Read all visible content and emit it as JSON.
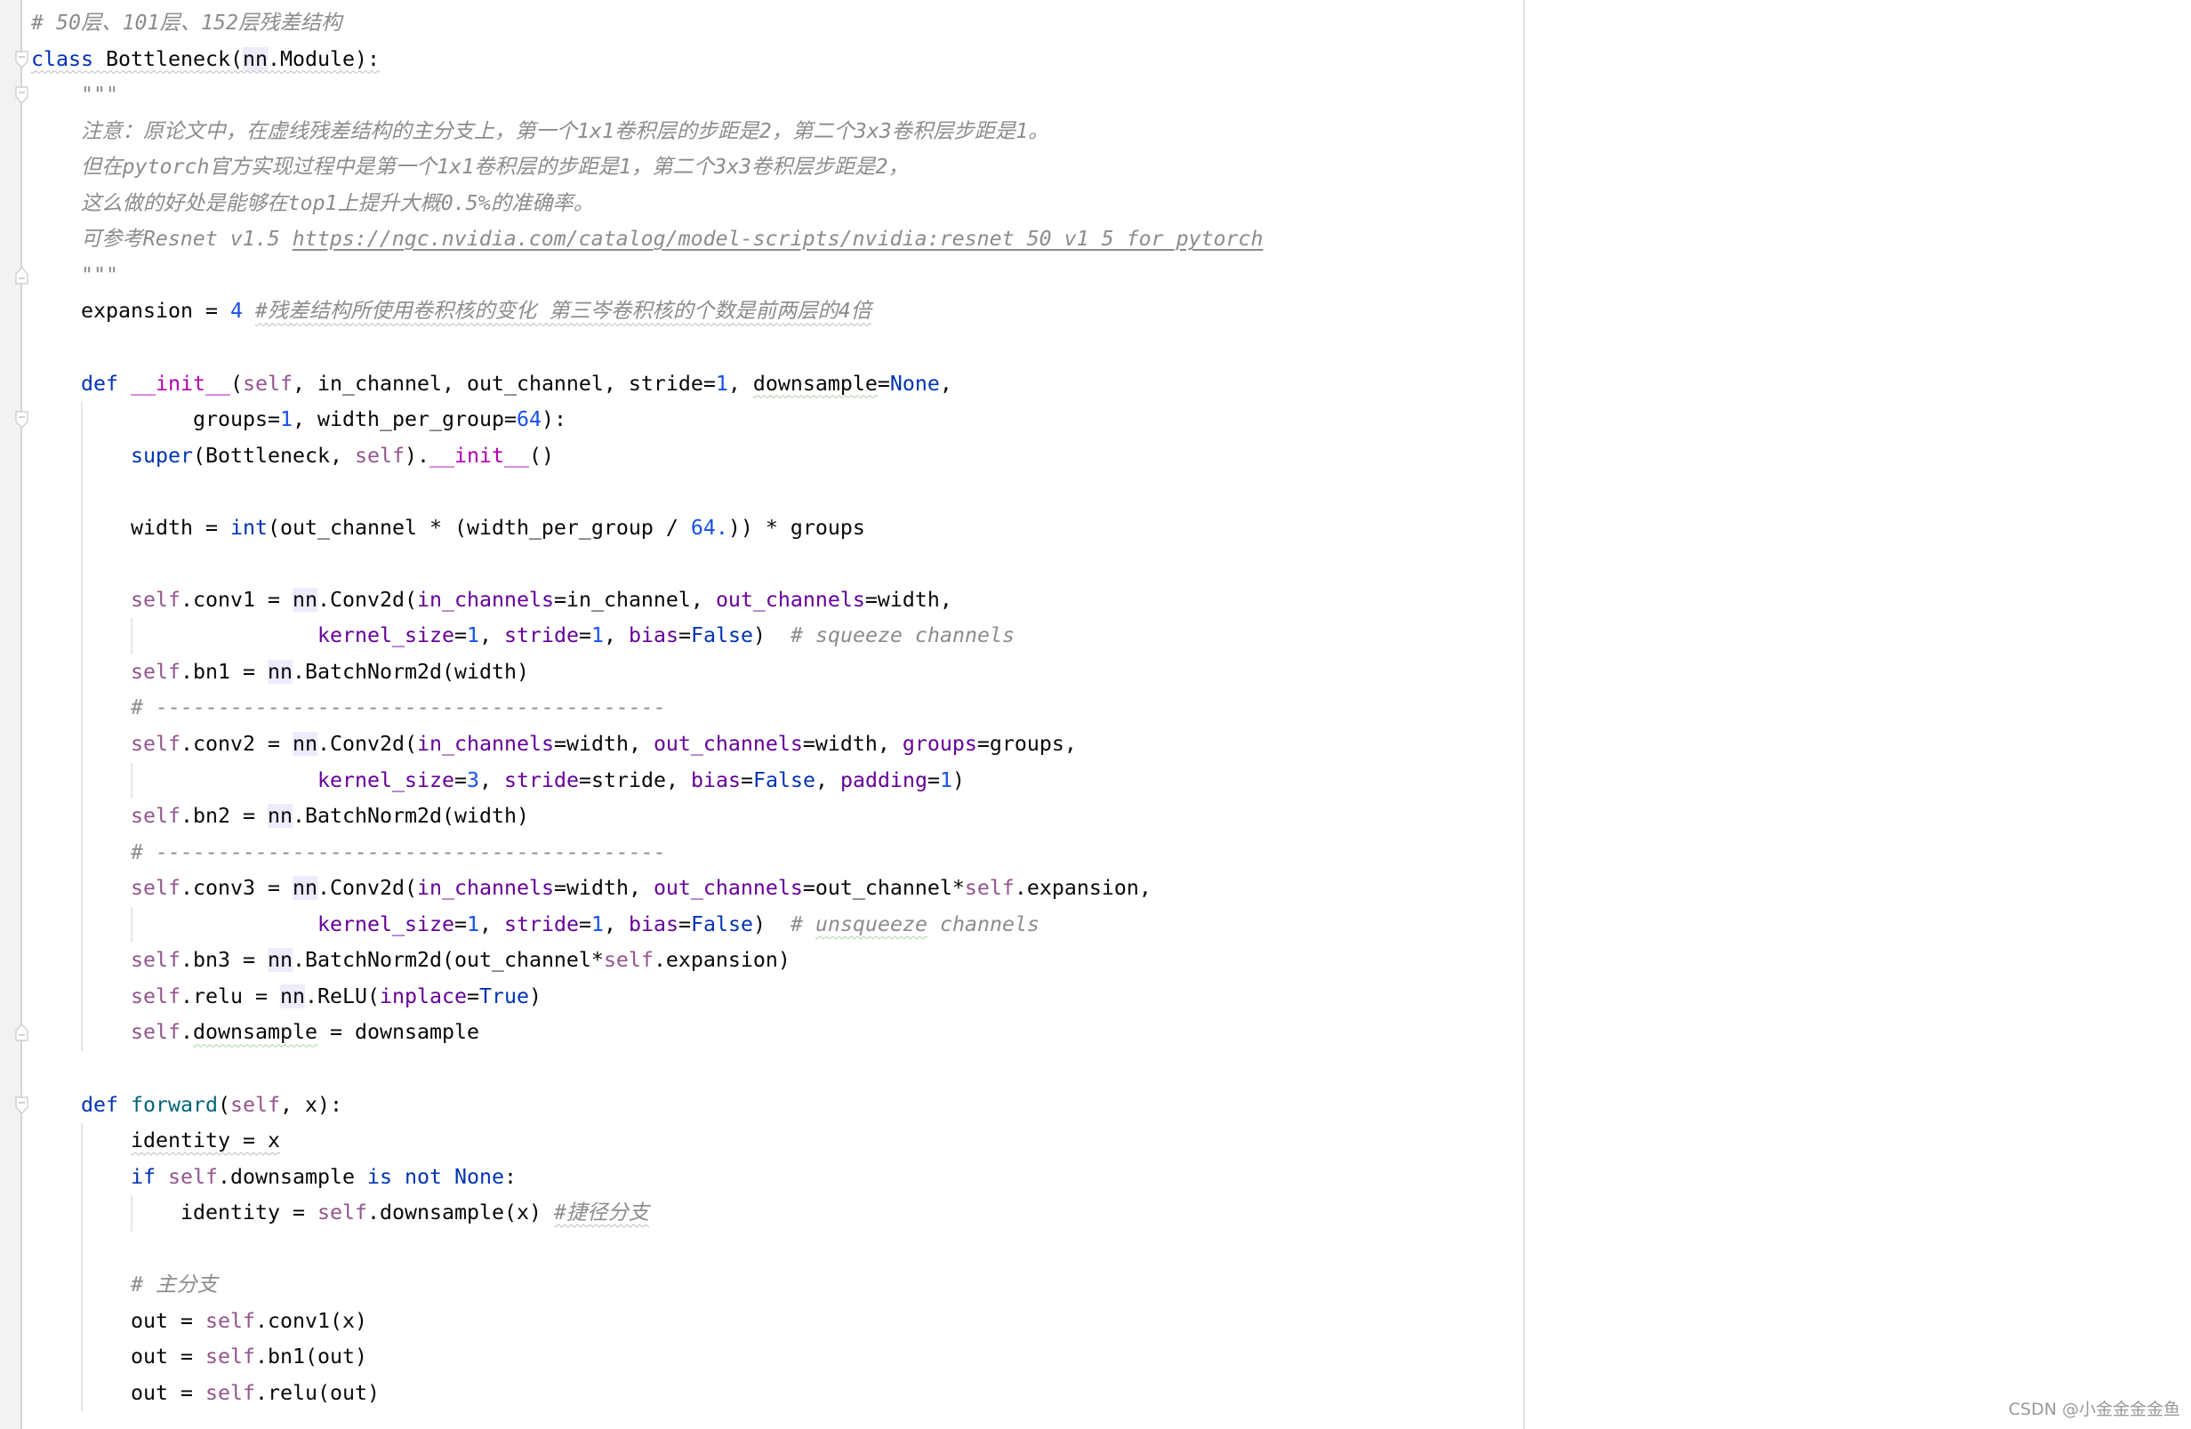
{
  "editor": {
    "language": "python",
    "lines": [
      {
        "indent": 0,
        "tokens": [
          {
            "t": "# 50层、101层、152层残差结构",
            "c": "cmt"
          }
        ]
      },
      {
        "indent": 0,
        "fold": "open",
        "tokens": [
          {
            "t": "class",
            "c": "kw sq-grey"
          },
          {
            "t": " Bottleneck(",
            "c": "plain sq-grey"
          },
          {
            "t": "nn",
            "c": "plain hl sq-grey"
          },
          {
            "t": ".Module):",
            "c": "plain sq-grey"
          }
        ]
      },
      {
        "indent": 4,
        "fold": "open",
        "tokens": [
          {
            "t": "\"\"\"",
            "c": "cmt"
          }
        ]
      },
      {
        "indent": 4,
        "tokens": [
          {
            "t": "注意：原论文中，在虚线残差结构的主分支上，第一个1x1卷积层的步距是2，第二个3x3卷积层步距是1。",
            "c": "cmt"
          }
        ]
      },
      {
        "indent": 4,
        "tokens": [
          {
            "t": "但在pytorch官方实现过程中是第一个1x1卷积层的步距是1，第二个3x3卷积层步距是2，",
            "c": "cmt"
          }
        ]
      },
      {
        "indent": 4,
        "tokens": [
          {
            "t": "这么做的好处是能够在top1上提升大概0.5%的准确率。",
            "c": "cmt"
          }
        ]
      },
      {
        "indent": 4,
        "tokens": [
          {
            "t": "可参考Resnet v1.5 ",
            "c": "cmt"
          },
          {
            "t": "https://ngc.nvidia.com/catalog/model-scripts/nvidia:resnet_50_v1_5_for_pytorch",
            "c": "url"
          }
        ]
      },
      {
        "indent": 4,
        "fold": "close",
        "tokens": [
          {
            "t": "\"\"\"",
            "c": "cmt"
          }
        ]
      },
      {
        "indent": 4,
        "tokens": [
          {
            "t": "expansion = ",
            "c": "plain"
          },
          {
            "t": "4",
            "c": "num"
          },
          {
            "t": " ",
            "c": "plain"
          },
          {
            "t": "#残差结构所使用卷积核的变化 第三岑卷积核的个数是前两层的4倍",
            "c": "cmt sq-grey"
          }
        ]
      },
      {
        "indent": 0,
        "tokens": []
      },
      {
        "indent": 4,
        "tokens": [
          {
            "t": "def",
            "c": "kw"
          },
          {
            "t": " ",
            "c": "plain"
          },
          {
            "t": "__init__",
            "c": "dunder"
          },
          {
            "t": "(",
            "c": "plain"
          },
          {
            "t": "self",
            "c": "self"
          },
          {
            "t": ", in_channel, out_channel, stride=",
            "c": "plain"
          },
          {
            "t": "1",
            "c": "num"
          },
          {
            "t": ", ",
            "c": "plain"
          },
          {
            "t": "downsample",
            "c": "plain sq-green"
          },
          {
            "t": "=",
            "c": "plain"
          },
          {
            "t": "None",
            "c": "kw"
          },
          {
            "t": ",",
            "c": "plain"
          }
        ]
      },
      {
        "indent": 13,
        "fold": "open",
        "tokens": [
          {
            "t": "groups=",
            "c": "plain"
          },
          {
            "t": "1",
            "c": "num"
          },
          {
            "t": ", width_per_group=",
            "c": "plain"
          },
          {
            "t": "64",
            "c": "num"
          },
          {
            "t": "):",
            "c": "plain"
          }
        ]
      },
      {
        "indent": 8,
        "tokens": [
          {
            "t": "super",
            "c": "kw"
          },
          {
            "t": "(Bottleneck, ",
            "c": "plain"
          },
          {
            "t": "self",
            "c": "self"
          },
          {
            "t": ").",
            "c": "plain"
          },
          {
            "t": "__init__",
            "c": "dunder"
          },
          {
            "t": "()",
            "c": "plain"
          }
        ]
      },
      {
        "indent": 0,
        "tokens": []
      },
      {
        "indent": 8,
        "tokens": [
          {
            "t": "width = ",
            "c": "plain"
          },
          {
            "t": "int",
            "c": "kw"
          },
          {
            "t": "(out_channel * (width_per_group / ",
            "c": "plain"
          },
          {
            "t": "64.",
            "c": "num"
          },
          {
            "t": ")) * groups",
            "c": "plain"
          }
        ]
      },
      {
        "indent": 0,
        "tokens": []
      },
      {
        "indent": 8,
        "tokens": [
          {
            "t": "self",
            "c": "self"
          },
          {
            "t": ".conv1 = ",
            "c": "plain"
          },
          {
            "t": "nn",
            "c": "plain hl"
          },
          {
            "t": ".Conv2d(",
            "c": "plain"
          },
          {
            "t": "in_channels",
            "c": "arg"
          },
          {
            "t": "=in_channel, ",
            "c": "plain"
          },
          {
            "t": "out_channels",
            "c": "arg"
          },
          {
            "t": "=width,",
            "c": "plain"
          }
        ]
      },
      {
        "indent": 23,
        "tokens": [
          {
            "t": "kernel_size",
            "c": "arg"
          },
          {
            "t": "=",
            "c": "plain"
          },
          {
            "t": "1",
            "c": "num"
          },
          {
            "t": ", ",
            "c": "plain"
          },
          {
            "t": "stride",
            "c": "arg"
          },
          {
            "t": "=",
            "c": "plain"
          },
          {
            "t": "1",
            "c": "num"
          },
          {
            "t": ", ",
            "c": "plain"
          },
          {
            "t": "bias",
            "c": "arg"
          },
          {
            "t": "=",
            "c": "plain"
          },
          {
            "t": "False",
            "c": "kw"
          },
          {
            "t": ")  ",
            "c": "plain"
          },
          {
            "t": "# squeeze channels",
            "c": "cmt"
          }
        ]
      },
      {
        "indent": 8,
        "tokens": [
          {
            "t": "self",
            "c": "self"
          },
          {
            "t": ".bn1 = ",
            "c": "plain"
          },
          {
            "t": "nn",
            "c": "plain hl"
          },
          {
            "t": ".BatchNorm2d(width)",
            "c": "plain"
          }
        ]
      },
      {
        "indent": 8,
        "tokens": [
          {
            "t": "# -----------------------------------------",
            "c": "cmt"
          }
        ]
      },
      {
        "indent": 8,
        "tokens": [
          {
            "t": "self",
            "c": "self"
          },
          {
            "t": ".conv2 = ",
            "c": "plain"
          },
          {
            "t": "nn",
            "c": "plain hl"
          },
          {
            "t": ".Conv2d(",
            "c": "plain"
          },
          {
            "t": "in_channels",
            "c": "arg"
          },
          {
            "t": "=width, ",
            "c": "plain"
          },
          {
            "t": "out_channels",
            "c": "arg"
          },
          {
            "t": "=width, ",
            "c": "plain"
          },
          {
            "t": "groups",
            "c": "arg"
          },
          {
            "t": "=groups,",
            "c": "plain"
          }
        ]
      },
      {
        "indent": 23,
        "tokens": [
          {
            "t": "kernel_size",
            "c": "arg"
          },
          {
            "t": "=",
            "c": "plain"
          },
          {
            "t": "3",
            "c": "num"
          },
          {
            "t": ", ",
            "c": "plain"
          },
          {
            "t": "stride",
            "c": "arg"
          },
          {
            "t": "=stride, ",
            "c": "plain"
          },
          {
            "t": "bias",
            "c": "arg"
          },
          {
            "t": "=",
            "c": "plain"
          },
          {
            "t": "False",
            "c": "kw"
          },
          {
            "t": ", ",
            "c": "plain"
          },
          {
            "t": "padding",
            "c": "arg"
          },
          {
            "t": "=",
            "c": "plain"
          },
          {
            "t": "1",
            "c": "num"
          },
          {
            "t": ")",
            "c": "plain"
          }
        ]
      },
      {
        "indent": 8,
        "tokens": [
          {
            "t": "self",
            "c": "self"
          },
          {
            "t": ".bn2 = ",
            "c": "plain"
          },
          {
            "t": "nn",
            "c": "plain hl"
          },
          {
            "t": ".BatchNorm2d(width)",
            "c": "plain"
          }
        ]
      },
      {
        "indent": 8,
        "tokens": [
          {
            "t": "# -----------------------------------------",
            "c": "cmt"
          }
        ]
      },
      {
        "indent": 8,
        "tokens": [
          {
            "t": "self",
            "c": "self"
          },
          {
            "t": ".conv3 = ",
            "c": "plain"
          },
          {
            "t": "nn",
            "c": "plain hl"
          },
          {
            "t": ".Conv2d(",
            "c": "plain"
          },
          {
            "t": "in_channels",
            "c": "arg"
          },
          {
            "t": "=width, ",
            "c": "plain"
          },
          {
            "t": "out_channels",
            "c": "arg"
          },
          {
            "t": "=out_channel*",
            "c": "plain"
          },
          {
            "t": "self",
            "c": "self"
          },
          {
            "t": ".expansion,",
            "c": "plain"
          }
        ]
      },
      {
        "indent": 23,
        "tokens": [
          {
            "t": "kernel_size",
            "c": "arg"
          },
          {
            "t": "=",
            "c": "plain"
          },
          {
            "t": "1",
            "c": "num"
          },
          {
            "t": ", ",
            "c": "plain"
          },
          {
            "t": "stride",
            "c": "arg"
          },
          {
            "t": "=",
            "c": "plain"
          },
          {
            "t": "1",
            "c": "num"
          },
          {
            "t": ", ",
            "c": "plain"
          },
          {
            "t": "bias",
            "c": "arg"
          },
          {
            "t": "=",
            "c": "plain"
          },
          {
            "t": "False",
            "c": "kw"
          },
          {
            "t": ")  ",
            "c": "plain"
          },
          {
            "t": "# ",
            "c": "cmt"
          },
          {
            "t": "unsqueeze",
            "c": "cmt sq-green"
          },
          {
            "t": " channels",
            "c": "cmt"
          }
        ]
      },
      {
        "indent": 8,
        "tokens": [
          {
            "t": "self",
            "c": "self"
          },
          {
            "t": ".bn3 = ",
            "c": "plain"
          },
          {
            "t": "nn",
            "c": "plain hl"
          },
          {
            "t": ".BatchNorm2d(out_channel*",
            "c": "plain"
          },
          {
            "t": "self",
            "c": "self"
          },
          {
            "t": ".expansion)",
            "c": "plain"
          }
        ]
      },
      {
        "indent": 8,
        "tokens": [
          {
            "t": "self",
            "c": "self"
          },
          {
            "t": ".relu = ",
            "c": "plain"
          },
          {
            "t": "nn",
            "c": "plain hl"
          },
          {
            "t": ".ReLU(",
            "c": "plain"
          },
          {
            "t": "inplace",
            "c": "arg"
          },
          {
            "t": "=",
            "c": "plain"
          },
          {
            "t": "True",
            "c": "kw"
          },
          {
            "t": ")",
            "c": "plain"
          }
        ]
      },
      {
        "indent": 8,
        "fold": "close",
        "tokens": [
          {
            "t": "self",
            "c": "self"
          },
          {
            "t": ".",
            "c": "plain"
          },
          {
            "t": "downsample",
            "c": "plain sq-green"
          },
          {
            "t": " = downsample",
            "c": "plain"
          }
        ]
      },
      {
        "indent": 0,
        "tokens": []
      },
      {
        "indent": 4,
        "fold": "open",
        "tokens": [
          {
            "t": "def",
            "c": "kw"
          },
          {
            "t": " ",
            "c": "plain"
          },
          {
            "t": "forward",
            "c": "fn"
          },
          {
            "t": "(",
            "c": "plain"
          },
          {
            "t": "self",
            "c": "self"
          },
          {
            "t": ", x):",
            "c": "plain"
          }
        ]
      },
      {
        "indent": 8,
        "tokens": [
          {
            "t": "identity = x",
            "c": "plain sq-grey"
          }
        ]
      },
      {
        "indent": 8,
        "tokens": [
          {
            "t": "if",
            "c": "kw"
          },
          {
            "t": " ",
            "c": "plain"
          },
          {
            "t": "self",
            "c": "self"
          },
          {
            "t": ".downsample ",
            "c": "plain"
          },
          {
            "t": "is not None",
            "c": "kw"
          },
          {
            "t": ":",
            "c": "plain"
          }
        ]
      },
      {
        "indent": 12,
        "tokens": [
          {
            "t": "identity = ",
            "c": "plain"
          },
          {
            "t": "self",
            "c": "self"
          },
          {
            "t": ".downsample(x) ",
            "c": "plain"
          },
          {
            "t": "#捷径分支",
            "c": "cmt sq-grey"
          }
        ]
      },
      {
        "indent": 0,
        "tokens": []
      },
      {
        "indent": 8,
        "tokens": [
          {
            "t": "# 主分支",
            "c": "cmt"
          }
        ]
      },
      {
        "indent": 8,
        "tokens": [
          {
            "t": "out = ",
            "c": "plain"
          },
          {
            "t": "self",
            "c": "self"
          },
          {
            "t": ".conv1(x)",
            "c": "plain"
          }
        ]
      },
      {
        "indent": 8,
        "tokens": [
          {
            "t": "out = ",
            "c": "plain"
          },
          {
            "t": "self",
            "c": "self"
          },
          {
            "t": ".bn1(out)",
            "c": "plain"
          }
        ]
      },
      {
        "indent": 8,
        "tokens": [
          {
            "t": "out = ",
            "c": "plain"
          },
          {
            "t": "self",
            "c": "self"
          },
          {
            "t": ".relu(out)",
            "c": "plain"
          }
        ]
      }
    ]
  },
  "colors": {
    "keyword": "#0033b3",
    "number": "#1750eb",
    "self": "#94558d",
    "named_arg": "#660099",
    "comment": "#8c8c8c",
    "function_name": "#00627a",
    "dunder": "#b200b2",
    "text": "#080808",
    "highlight_bg": "#edebfc"
  },
  "watermark": "CSDN @小金金金金鱼"
}
